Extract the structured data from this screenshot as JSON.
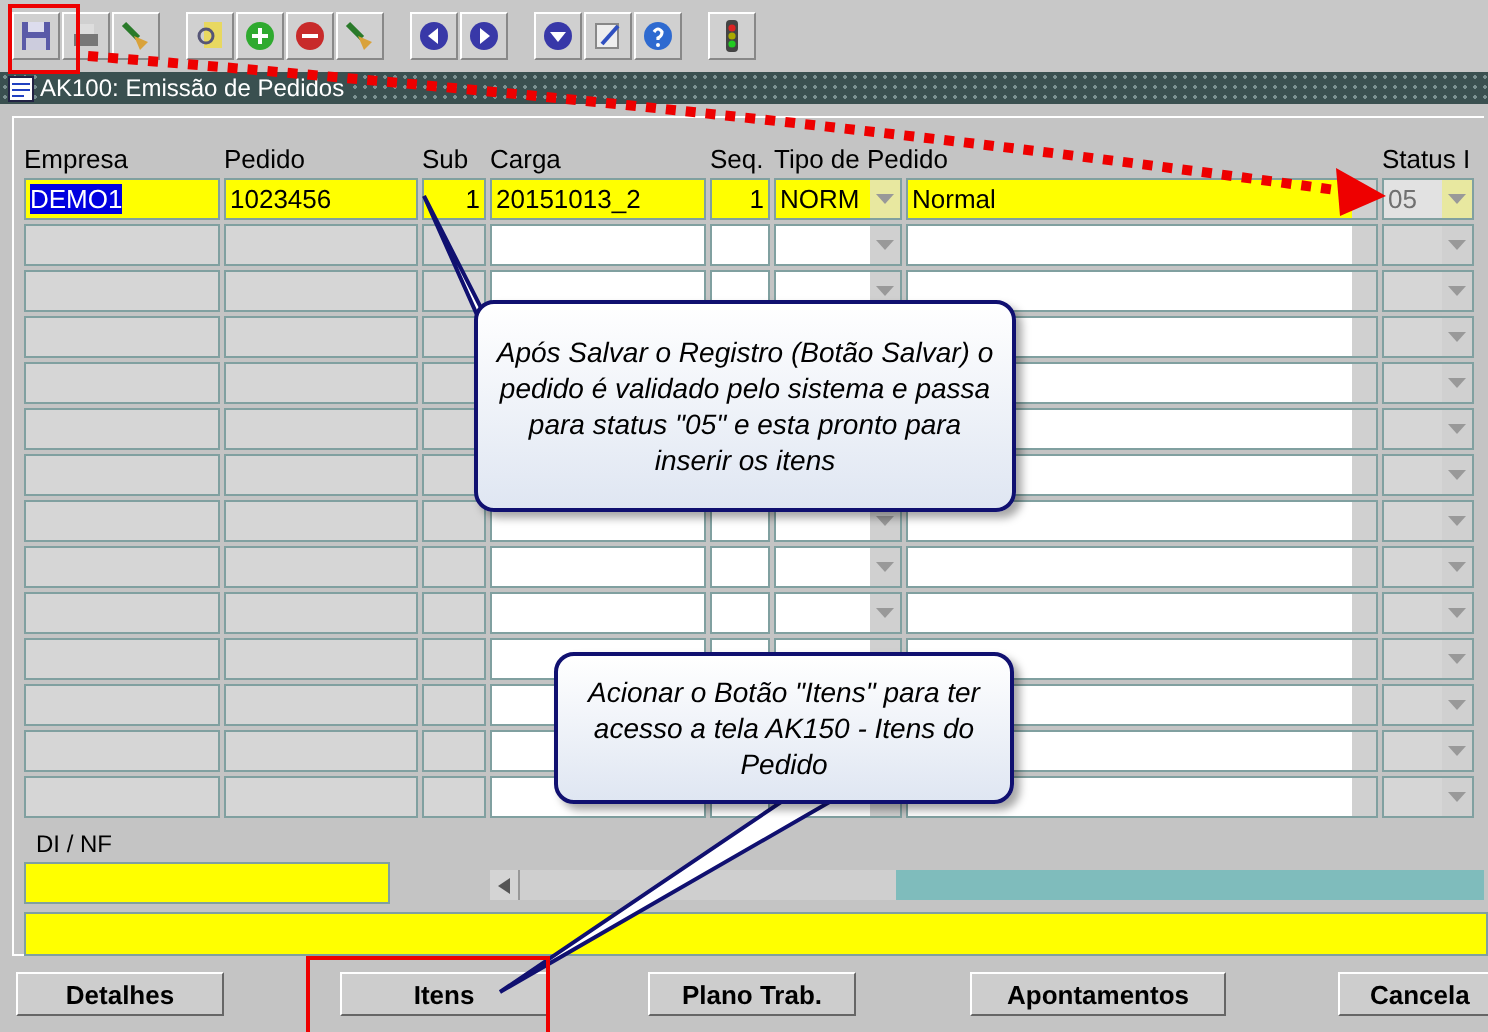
{
  "window": {
    "title": "AK100: Emissão de Pedidos"
  },
  "columns": [
    {
      "label": "Empresa",
      "kind": "text",
      "editable": false
    },
    {
      "label": "Pedido",
      "kind": "text",
      "editable": false
    },
    {
      "label": "Sub",
      "kind": "number",
      "editable": false
    },
    {
      "label": "Carga",
      "kind": "text",
      "editable": true
    },
    {
      "label": "Seq.",
      "kind": "number",
      "editable": true
    },
    {
      "label": "Tipo de Pedido",
      "kind": "combo",
      "editable": true
    },
    {
      "kind": "description",
      "editable": true
    },
    {
      "label": "Status I",
      "kind": "status",
      "editable": false
    }
  ],
  "rows": [
    {
      "current": true,
      "cells": [
        {
          "value": "DEMO1",
          "selected": true
        },
        {
          "value": "1023456",
          "selected": false
        },
        {
          "value": "1",
          "selected": false
        },
        {
          "value": "20151013_2",
          "selected": false
        },
        {
          "value": "1",
          "selected": false
        },
        {
          "value": "NORM",
          "selected": false
        },
        {
          "value": "Normal",
          "selected": false
        },
        {
          "value": "05",
          "selected": false
        }
      ]
    },
    {
      "current": false
    },
    {
      "current": false
    },
    {
      "current": false
    },
    {
      "current": false
    },
    {
      "current": false
    },
    {
      "current": false
    },
    {
      "current": false
    },
    {
      "current": false
    },
    {
      "current": false
    },
    {
      "current": false
    },
    {
      "current": false
    },
    {
      "current": false
    },
    {
      "current": false
    }
  ],
  "di_nf": {
    "label": "DI / NF"
  },
  "buttons": [
    "Detalhes",
    "Itens",
    "Plano Trab.",
    "Apontamentos",
    "Cancela"
  ],
  "callouts": [
    {
      "text": "Após Salvar o Registro (Botão Salvar) o pedido é validado pelo sistema e passa para status \"05\" e esta pronto para inserir os itens"
    },
    {
      "text": "Acionar o Botão \"Itens\" para ter acesso a tela AK150 - Itens do Pedido"
    }
  ]
}
